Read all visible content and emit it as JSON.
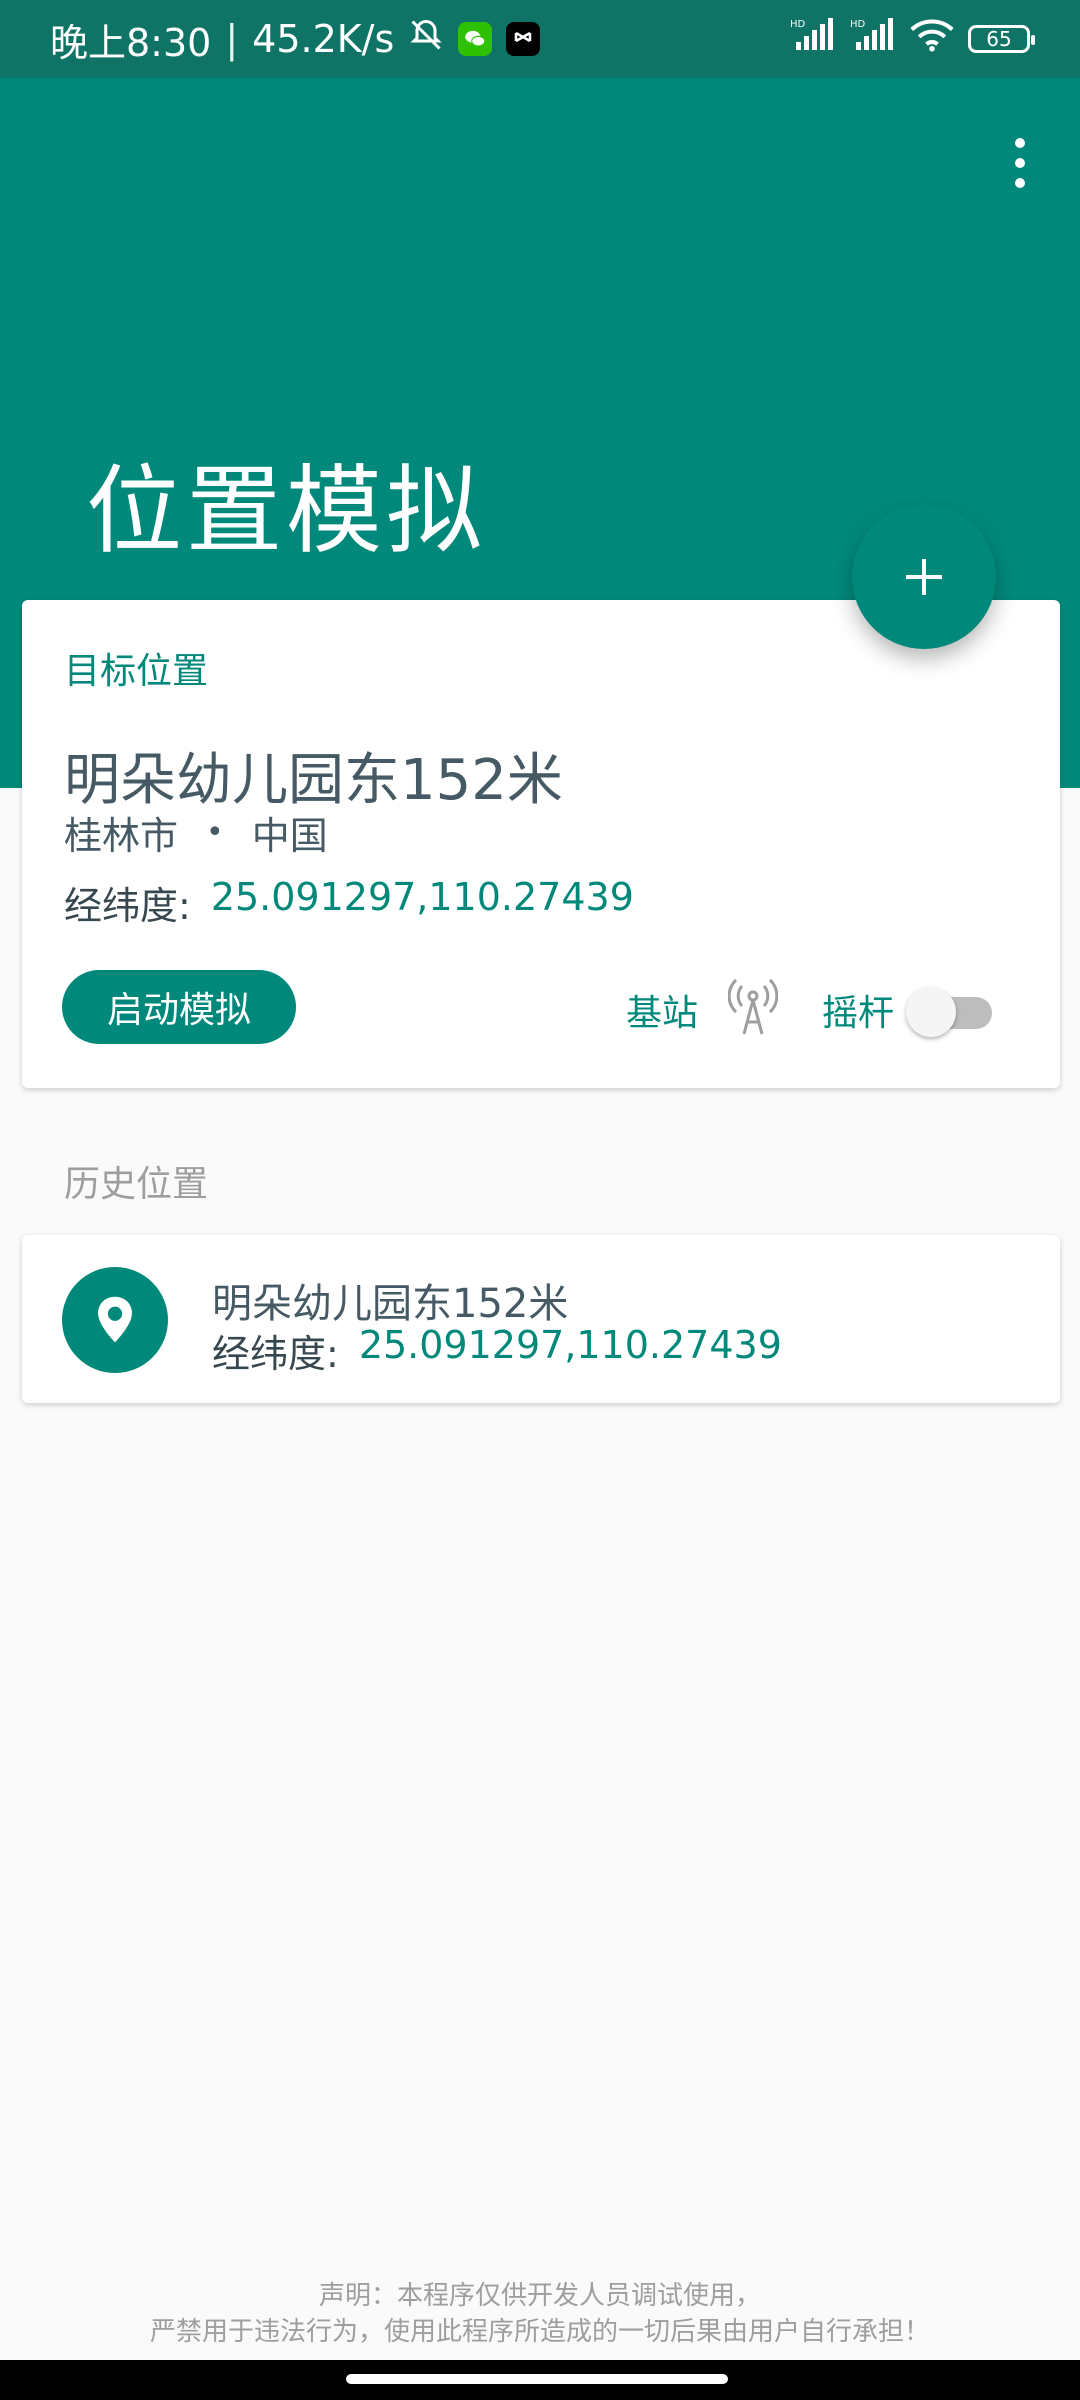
{
  "status_bar": {
    "time": "晚上8:30",
    "separator": "|",
    "speed": "45.2K/s",
    "battery": "65",
    "hd_label": "HD"
  },
  "header": {
    "title": "位置模拟"
  },
  "target": {
    "label": "目标位置",
    "name": "明朵幼儿园东152米",
    "city": "桂林市",
    "separator": "•",
    "country": "中国",
    "coord_label": "经纬度:",
    "coord_value": "25.091297,110.27439",
    "start_label": "启动模拟",
    "cell_label": "基站",
    "joystick_label": "摇杆",
    "joystick_on": false
  },
  "history": {
    "title": "历史位置",
    "items": [
      {
        "name": "明朵幼儿园东152米",
        "coord_label": "经纬度:",
        "coord_value": "25.091297,110.27439"
      }
    ]
  },
  "disclaimer": {
    "line1": "声明：本程序仅供开发人员调试使用，",
    "line2": "严禁用于违法行为，使用此程序所造成的一切后果由用户自行承担！"
  },
  "colors": {
    "primary": "#00897b",
    "status_bar": "#0f7466",
    "text_dark": "#455a64",
    "text_muted": "#9e9e9e"
  },
  "icons": [
    "bell-off-icon",
    "wechat-icon",
    "capcut-icon",
    "signal-icon",
    "wifi-icon",
    "battery-icon",
    "more-vert-icon",
    "plus-icon",
    "cell-tower-icon",
    "location-pin-icon"
  ]
}
